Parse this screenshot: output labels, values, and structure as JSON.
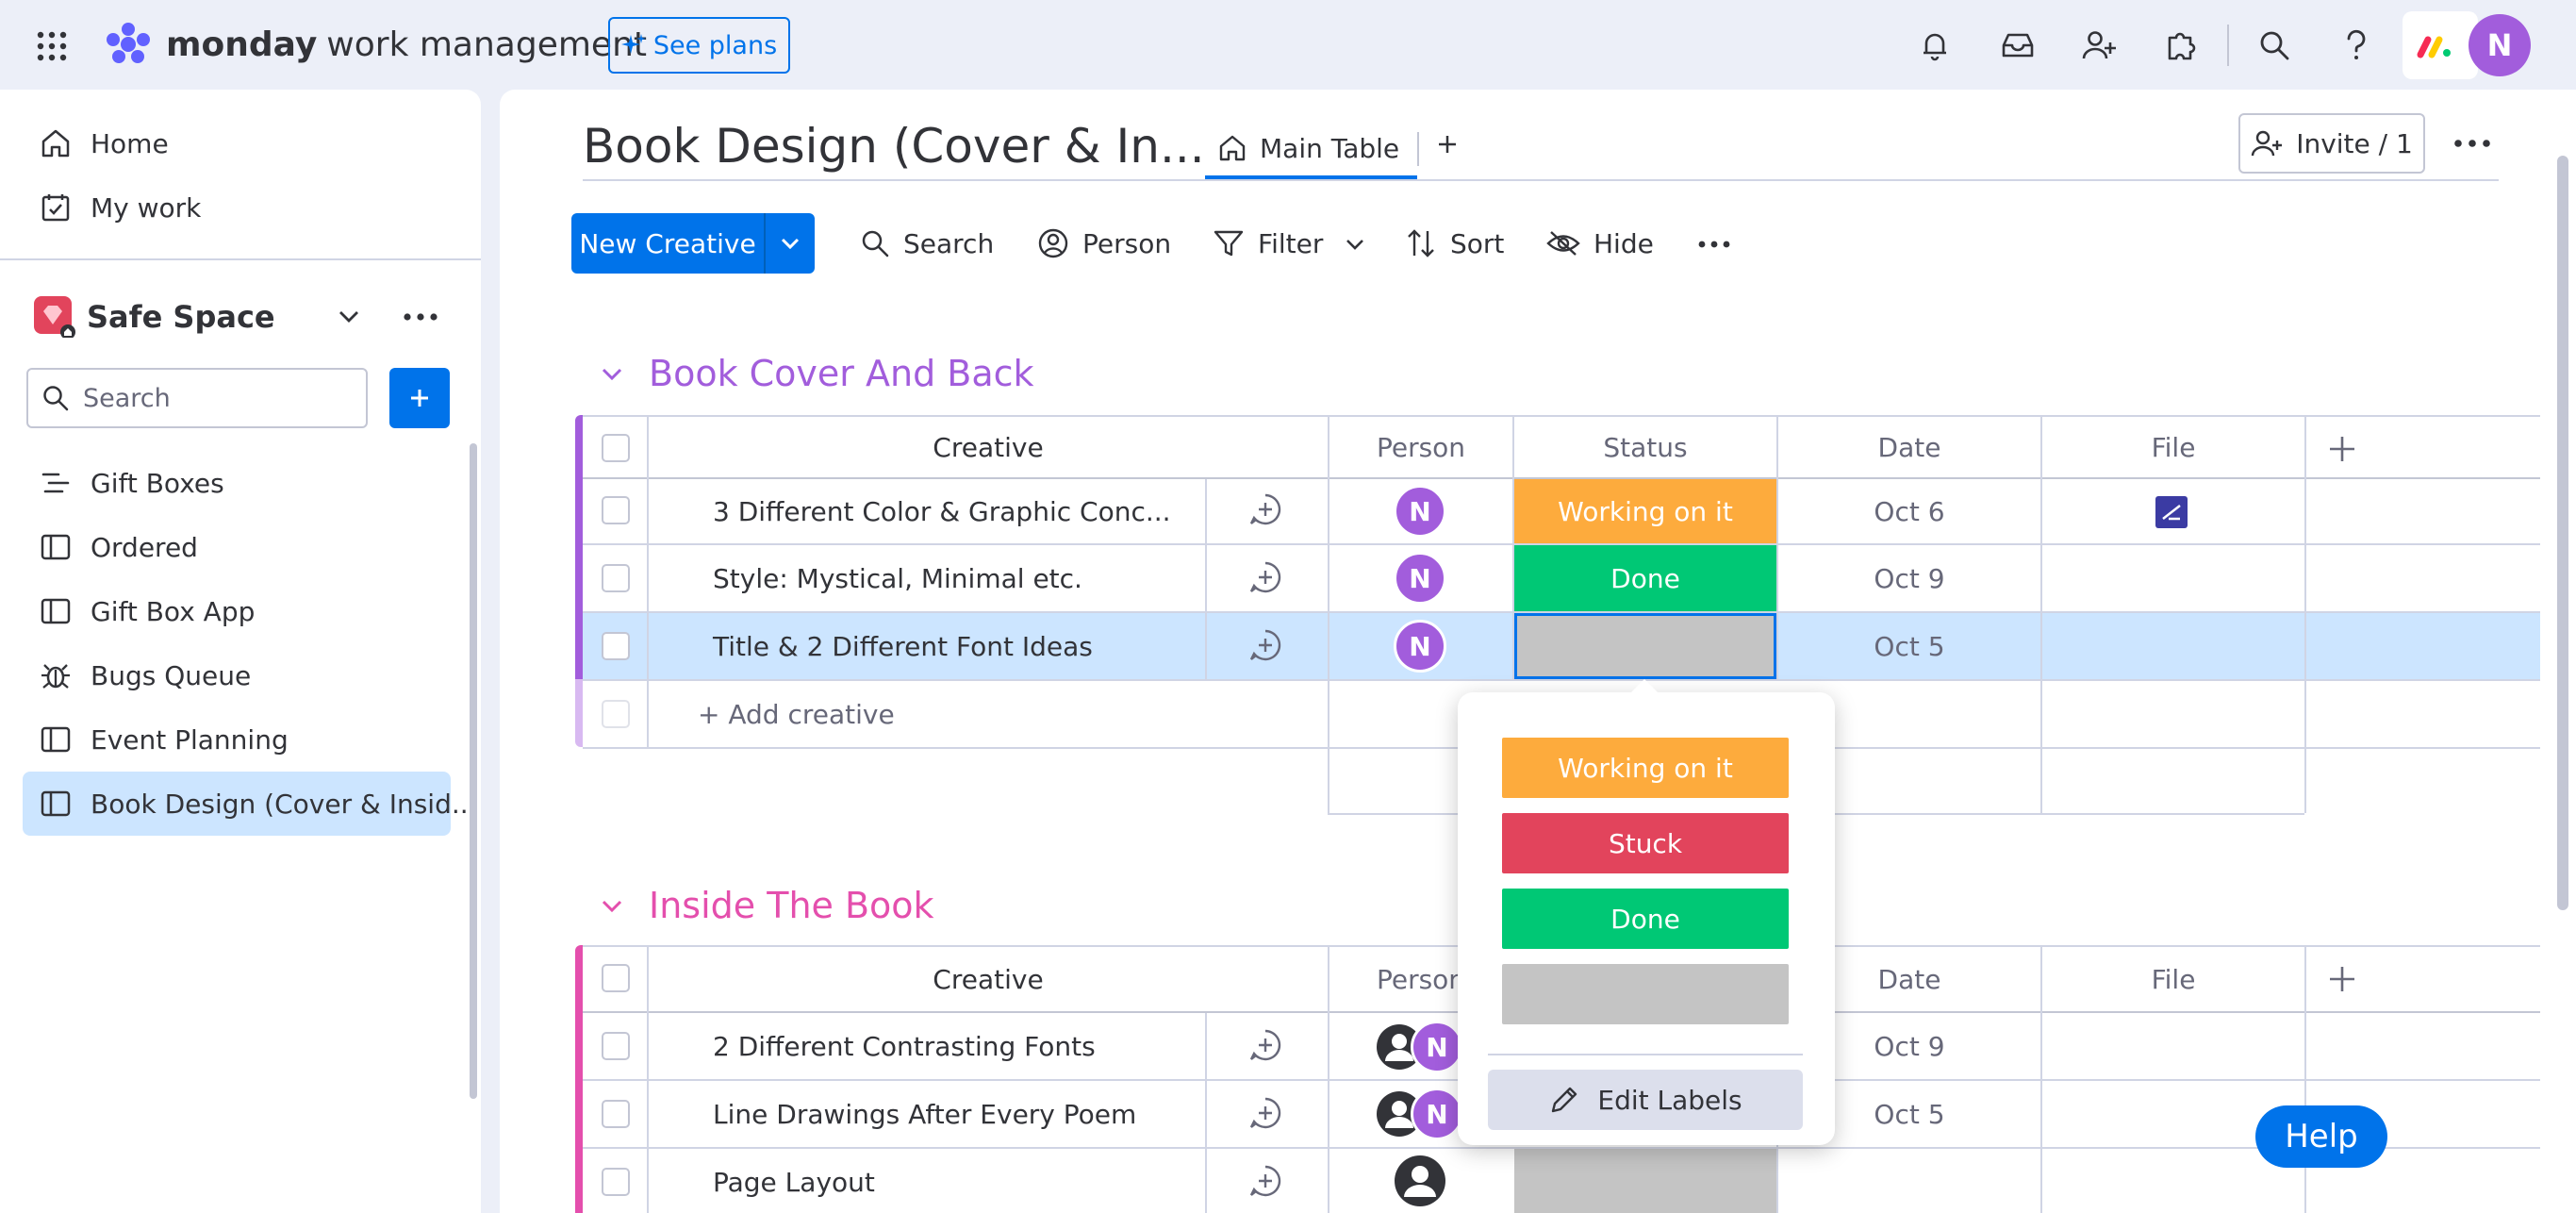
{
  "app": {
    "brand_bold": "monday",
    "brand_light": "work management",
    "see_plans": "See plans",
    "user_initial": "N"
  },
  "sidebar": {
    "home": "Home",
    "my_work": "My work",
    "workspace": "Safe Space",
    "search_placeholder": "Search",
    "items": [
      {
        "label": "Gift Boxes",
        "icon": "gantt-icon"
      },
      {
        "label": "Ordered",
        "icon": "board-icon"
      },
      {
        "label": "Gift Box App",
        "icon": "board-icon"
      },
      {
        "label": "Bugs Queue",
        "icon": "bug-icon"
      },
      {
        "label": "Event Planning",
        "icon": "board-icon"
      },
      {
        "label": "Book Design (Cover & Insid...",
        "icon": "board-icon"
      }
    ]
  },
  "board": {
    "title": "Book Design (Cover & In...",
    "tab_main": "Main Table",
    "invite": "Invite / 1",
    "toolbar": {
      "new_item": "New Creative",
      "search": "Search",
      "person": "Person",
      "filter": "Filter",
      "sort": "Sort",
      "hide": "Hide"
    }
  },
  "columns": {
    "creative": "Creative",
    "person": "Person",
    "status": "Status",
    "date": "Date",
    "file": "File"
  },
  "groups": [
    {
      "title": "Book Cover And Back",
      "color": "#a25ddc",
      "rows": [
        {
          "name": "3 Different Color & Graphic Conc...",
          "status": "Working on it",
          "date": "Oct 6"
        },
        {
          "name": "Style: Mystical, Minimal etc.",
          "status": "Done",
          "date": "Oct 9"
        },
        {
          "name": "Title & 2 Different Font Ideas",
          "status": "",
          "date": "Oct 5"
        }
      ],
      "add_item": "+ Add creative"
    },
    {
      "title": "Inside The Book",
      "color": "#e44fad",
      "rows": [
        {
          "name": "2 Different Contrasting Fonts",
          "date": "Oct 9"
        },
        {
          "name": "Line Drawings After Every Poem",
          "date": "Oct 5"
        },
        {
          "name": "Page Layout",
          "date": ""
        }
      ]
    }
  ],
  "status_popup": {
    "options": [
      {
        "label": "Working on it",
        "color": "#fdab3d"
      },
      {
        "label": "Stuck",
        "color": "#e2445c"
      },
      {
        "label": "Done",
        "color": "#00c875"
      },
      {
        "label": "",
        "color": "#c4c4c4"
      }
    ],
    "edit_labels": "Edit Labels"
  },
  "help": "Help",
  "colors": {
    "primary": "#0073ea",
    "working": "#fdab3d",
    "stuck": "#e2445c",
    "done": "#00c875",
    "blank": "#c4c4c4",
    "selected_row": "#cce5ff"
  }
}
